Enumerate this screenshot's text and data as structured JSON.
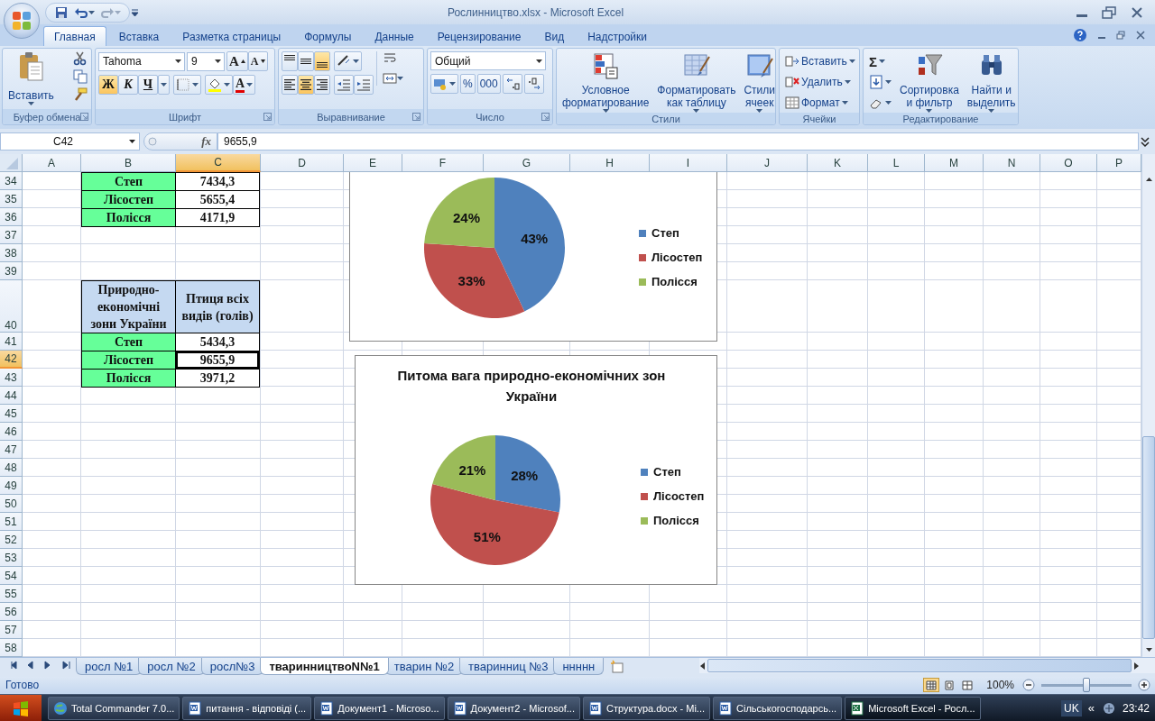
{
  "window": {
    "title": "Рослинництво.xlsx - Microsoft Excel"
  },
  "tabs": [
    {
      "label": "Главная",
      "selected": true
    },
    {
      "label": "Вставка",
      "selected": false
    },
    {
      "label": "Разметка страницы",
      "selected": false
    },
    {
      "label": "Формулы",
      "selected": false
    },
    {
      "label": "Данные",
      "selected": false
    },
    {
      "label": "Рецензирование",
      "selected": false
    },
    {
      "label": "Вид",
      "selected": false
    },
    {
      "label": "Надстройки",
      "selected": false
    }
  ],
  "ribbon": {
    "clipboard": {
      "paste": "Вставить",
      "label": "Буфер обмена"
    },
    "font": {
      "family": "Tahoma",
      "size": "9",
      "grow": "A",
      "shrink": "A",
      "styles": [
        {
          "kind": "bold",
          "label": "Ж",
          "on": true
        },
        {
          "kind": "italic",
          "label": "К",
          "on": false
        },
        {
          "kind": "underline",
          "label": "Ч",
          "on": false
        }
      ],
      "font_color": "A",
      "label": "Шрифт"
    },
    "alignment": {
      "vertical": [
        {
          "kind": "top",
          "selected": false
        },
        {
          "kind": "middle",
          "selected": false
        },
        {
          "kind": "bottom",
          "selected": true
        }
      ],
      "horizontal": [
        {
          "kind": "left",
          "selected": false
        },
        {
          "kind": "center",
          "selected": true
        },
        {
          "kind": "right",
          "selected": false
        }
      ],
      "label": "Выравнивание"
    },
    "number": {
      "format": "Общий",
      "percent": "%",
      "thousands": "000",
      "label": "Число"
    },
    "styles": {
      "buttons": [
        {
          "kind": "conditional",
          "label": "Условное\nформатирование"
        },
        {
          "kind": "table",
          "label": "Форматировать\nкак таблицу"
        },
        {
          "kind": "cellstyle",
          "label": "Стили\nячеек"
        }
      ],
      "label": "Стили"
    },
    "cells": {
      "buttons": [
        {
          "kind": "insert",
          "label": "Вставить"
        },
        {
          "kind": "delete",
          "label": "Удалить"
        },
        {
          "kind": "format",
          "label": "Формат"
        }
      ],
      "label": "Ячейки"
    },
    "editing": {
      "sum": "Σ",
      "buttons": [
        {
          "kind": "sort",
          "label": "Сортировка\nи фильтр"
        },
        {
          "kind": "find",
          "label": "Найти и\nвыделить"
        }
      ],
      "label": "Редактирование"
    }
  },
  "formula_bar": {
    "name_box": "C42",
    "function_label": "fx",
    "value": "9655,9"
  },
  "sheet": {
    "columns": [
      {
        "label": "A",
        "selected": false
      },
      {
        "label": "B",
        "selected": false
      },
      {
        "label": "C",
        "selected": true
      },
      {
        "label": "D",
        "selected": false
      },
      {
        "label": "E",
        "selected": false
      },
      {
        "label": "F",
        "selected": false
      },
      {
        "label": "G",
        "selected": false
      },
      {
        "label": "H",
        "selected": false
      },
      {
        "label": "I",
        "selected": false
      },
      {
        "label": "J",
        "selected": false
      },
      {
        "label": "K",
        "selected": false
      },
      {
        "label": "L",
        "selected": false
      },
      {
        "label": "M",
        "selected": false
      },
      {
        "label": "N",
        "selected": false
      },
      {
        "label": "O",
        "selected": false
      },
      {
        "label": "P",
        "selected": false
      }
    ],
    "rows": [
      {
        "number": "34",
        "selected": false,
        "kind": "data",
        "zone": "Степ",
        "value": "7434,3"
      },
      {
        "number": "35",
        "selected": false,
        "kind": "data",
        "zone": "Лісостеп",
        "value": "5655,4"
      },
      {
        "number": "36",
        "selected": false,
        "kind": "data",
        "zone": "Полісся",
        "value": "4171,9"
      },
      {
        "number": "37",
        "selected": false,
        "kind": "empty"
      },
      {
        "number": "38",
        "selected": false,
        "kind": "empty"
      },
      {
        "number": "39",
        "selected": false,
        "kind": "empty"
      },
      {
        "number": "40",
        "selected": false,
        "kind": "header",
        "zone": "Природно-\nекономічні\nзони України",
        "value": "Птиця всіх\nвидів (голів)"
      },
      {
        "number": "41",
        "selected": false,
        "kind": "data",
        "zone": "Степ",
        "value": "5434,3"
      },
      {
        "number": "42",
        "selected": true,
        "kind": "data",
        "zone": "Лісостеп",
        "value": "9655,9"
      },
      {
        "number": "43",
        "selected": false,
        "kind": "data",
        "zone": "Полісся",
        "value": "3971,2"
      },
      {
        "number": "44",
        "selected": false,
        "kind": "empty"
      },
      {
        "number": "45",
        "selected": false,
        "kind": "empty"
      },
      {
        "number": "46",
        "selected": false,
        "kind": "empty"
      },
      {
        "number": "47",
        "selected": false,
        "kind": "empty"
      },
      {
        "number": "48",
        "selected": false,
        "kind": "empty"
      },
      {
        "number": "49",
        "selected": false,
        "kind": "empty"
      },
      {
        "number": "50",
        "selected": false,
        "kind": "empty"
      },
      {
        "number": "51",
        "selected": false,
        "kind": "empty"
      },
      {
        "number": "52",
        "selected": false,
        "kind": "empty"
      },
      {
        "number": "53",
        "selected": false,
        "kind": "empty"
      },
      {
        "number": "54",
        "selected": false,
        "kind": "empty"
      },
      {
        "number": "55",
        "selected": false,
        "kind": "empty"
      },
      {
        "number": "56",
        "selected": false,
        "kind": "empty"
      },
      {
        "number": "57",
        "selected": false,
        "kind": "empty"
      },
      {
        "number": "58",
        "selected": false,
        "kind": "empty"
      }
    ]
  },
  "charts": [
    {
      "slices": [
        {
          "color": "#4f81bd"
        },
        {
          "color": "#c0504d"
        },
        {
          "color": "#9bbb59"
        }
      ],
      "chart_data": {
        "type": "pie",
        "categories": [
          "Степ",
          "Лісостеп",
          "Полісся"
        ],
        "values": [
          43,
          33,
          24
        ],
        "value_labels": [
          "43%",
          "33%",
          "24%"
        ],
        "legend": "right"
      }
    },
    {
      "slices": [
        {
          "color": "#4f81bd"
        },
        {
          "color": "#c0504d"
        },
        {
          "color": "#9bbb59"
        }
      ],
      "chart_data": {
        "type": "pie",
        "legend": "right",
        "title": "Питома вага природно-економічних зон України",
        "categories": [
          "Степ",
          "Лісостеп",
          "Полісся"
        ],
        "values": [
          28,
          51,
          21
        ],
        "value_labels": [
          "28%",
          "51%",
          "21%"
        ]
      }
    }
  ],
  "sheet_tabs": [
    {
      "label": "росл №1",
      "selected": false
    },
    {
      "label": "росл №2",
      "selected": false
    },
    {
      "label": "росл№3",
      "selected": false
    },
    {
      "label": "тваринництвоN№1",
      "selected": true
    },
    {
      "label": "тварин №2",
      "selected": false
    },
    {
      "label": "тваринниц №3",
      "selected": false
    },
    {
      "label": "ннннн",
      "selected": false
    }
  ],
  "status_bar": {
    "text": "Готово",
    "views": [
      {
        "kind": "normal",
        "selected": true
      },
      {
        "kind": "layout",
        "selected": false
      },
      {
        "kind": "pagebreak",
        "selected": false
      }
    ],
    "zoom": "100%",
    "zoom_slider": {
      "level": 0.5
    }
  },
  "taskbar": {
    "items": [
      {
        "kind": "web",
        "label": "Total Commander 7.0...",
        "selected": false
      },
      {
        "kind": "word",
        "label": "питання - відповіді (...",
        "selected": false
      },
      {
        "kind": "word",
        "label": "Документ1 - Microso...",
        "selected": false
      },
      {
        "kind": "word",
        "label": "Документ2 - Microsof...",
        "selected": false
      },
      {
        "kind": "word",
        "label": "Структура.docx - Mi...",
        "selected": false
      },
      {
        "kind": "word",
        "label": "Сільськогосподарсь...",
        "selected": false
      },
      {
        "kind": "excel",
        "label": "Microsoft Excel - Росл...",
        "selected": true
      }
    ],
    "language": "UK",
    "tray_toggle": "«",
    "clock": "23:42"
  }
}
